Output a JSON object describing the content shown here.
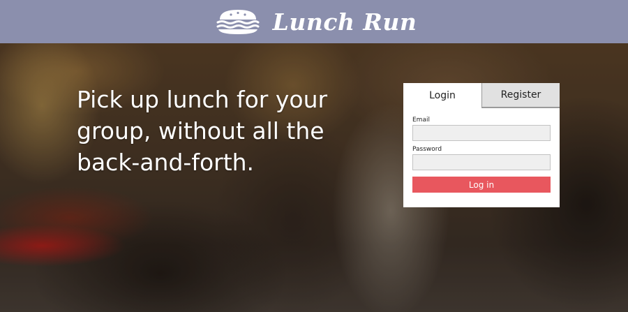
{
  "header": {
    "brand_name": "Lunch Run",
    "logo_icon": "sandwich-icon",
    "background": "#8b8fad"
  },
  "hero": {
    "headline": "Pick up lunch for your group, without all the back-and-forth."
  },
  "auth": {
    "tabs": [
      {
        "label": "Login",
        "active": true
      },
      {
        "label": "Register",
        "active": false
      }
    ],
    "email_label": "Email",
    "email_value": "",
    "password_label": "Password",
    "password_value": "",
    "submit_label": "Log in",
    "accent_color": "#e8575e"
  }
}
